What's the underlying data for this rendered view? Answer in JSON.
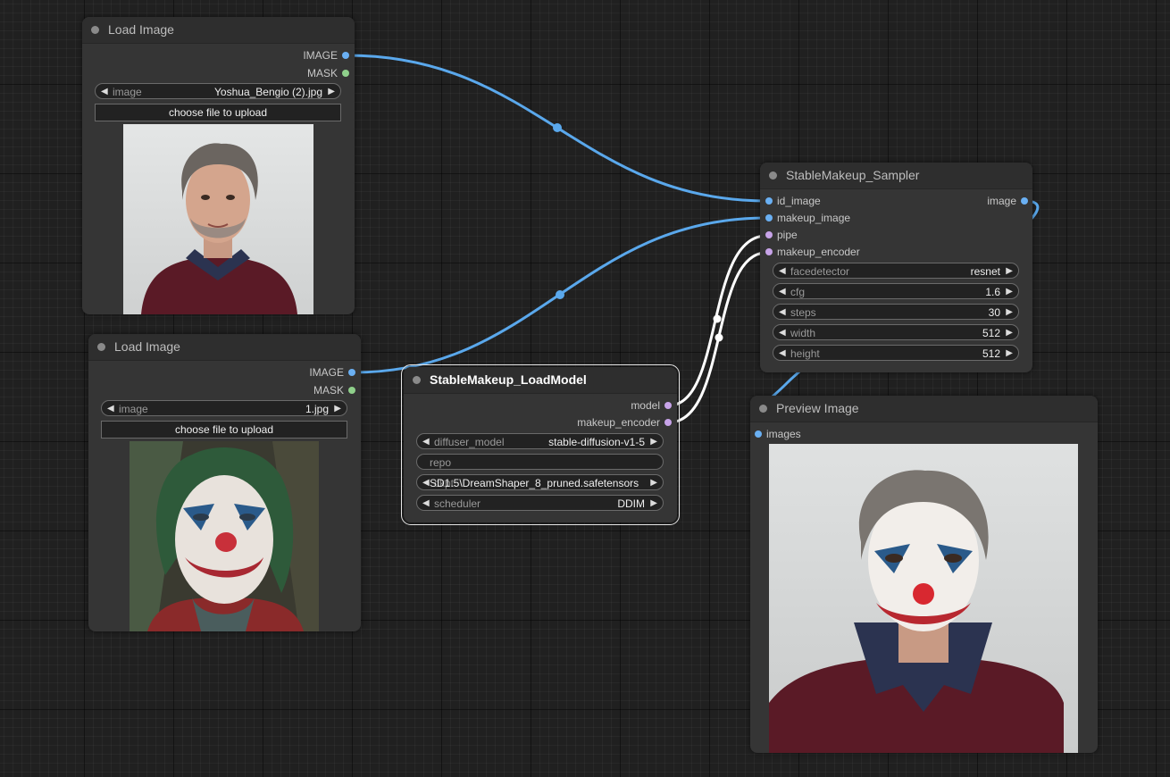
{
  "nodes": {
    "load1": {
      "title": "Load Image",
      "outputs": [
        "IMAGE",
        "MASK"
      ],
      "image_widget": {
        "label": "image",
        "value": "Yoshua_Bengio (2).jpg"
      },
      "upload_button": "choose file to upload"
    },
    "load2": {
      "title": "Load Image",
      "outputs": [
        "IMAGE",
        "MASK"
      ],
      "image_widget": {
        "label": "image",
        "value": "1.jpg"
      },
      "upload_button": "choose file to upload"
    },
    "loadmodel": {
      "title": "StableMakeup_LoadModel",
      "outputs": [
        "model",
        "makeup_encoder"
      ],
      "widgets": {
        "diffuser_model": {
          "label": "diffuser_model",
          "value": "stable-diffusion-v1-5"
        },
        "repo": {
          "label": "repo",
          "value": ""
        },
        "ckpt": {
          "label": "ckpt",
          "value": "SD1.5\\DreamShaper_8_pruned.safetensors"
        },
        "scheduler": {
          "label": "scheduler",
          "value": "DDIM"
        }
      }
    },
    "sampler": {
      "title": "StableMakeup_Sampler",
      "inputs": [
        "id_image",
        "makeup_image",
        "pipe",
        "makeup_encoder"
      ],
      "outputs": [
        "image"
      ],
      "widgets": [
        {
          "label": "facedetector",
          "value": "resnet"
        },
        {
          "label": "cfg",
          "value": "1.6"
        },
        {
          "label": "steps",
          "value": "30"
        },
        {
          "label": "width",
          "value": "512"
        },
        {
          "label": "height",
          "value": "512"
        }
      ]
    },
    "preview": {
      "title": "Preview Image",
      "inputs": [
        "images"
      ]
    }
  },
  "colors": {
    "image_link": "#5aa8ec",
    "model_link": "#ffffff",
    "image_slot": "#6ab0f3",
    "mask_slot": "#8fd08b",
    "model_slot": "#c7a3e8"
  },
  "icons": {
    "left_arrow": "◀",
    "right_arrow": "▶"
  }
}
